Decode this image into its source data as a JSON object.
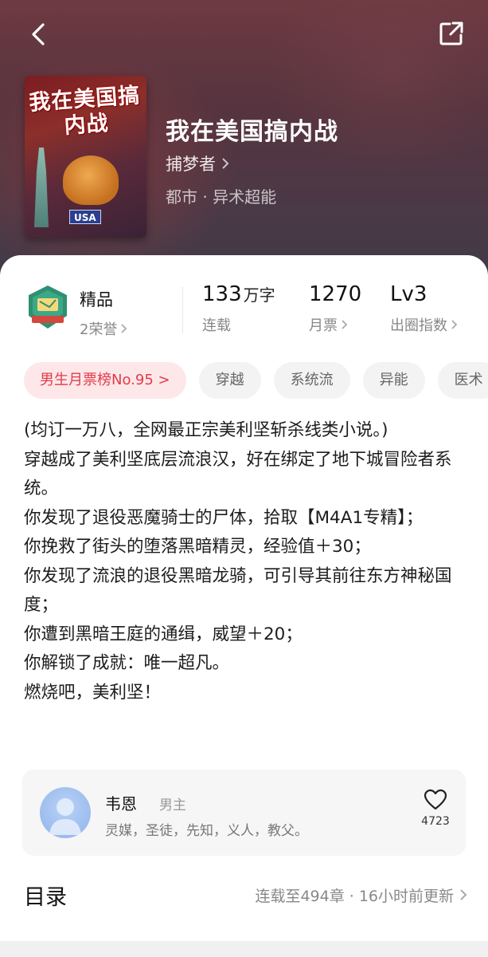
{
  "header": {
    "back_icon": "back-arrow-icon",
    "share_icon": "share-icon"
  },
  "book": {
    "cover_title": "我在美国搞内战",
    "cover_badge": "USA",
    "title": "我在美国搞内战",
    "author": "捕梦者",
    "genre": "都市 · 异术超能"
  },
  "stats": {
    "quality_label": "精品",
    "honors": "2荣誉",
    "words_value": "133",
    "words_unit": "万字",
    "words_label": "连载",
    "tickets_value": "1270",
    "tickets_label": "月票",
    "level_value": "Lv3",
    "level_label": "出圈指数"
  },
  "tags": [
    "男生月票榜No.95 >",
    "穿越",
    "系统流",
    "异能",
    "医术"
  ],
  "description": [
    "(均订一万八，全网最正宗美利坚斩杀线类小说。)",
    "穿越成了美利坚底层流浪汉，好在绑定了地下城冒险者系统。",
    "你发现了退役恶魔骑士的尸体，拾取【M4A1专精】；",
    "你挽救了街头的堕落黑暗精灵，经验值＋30；",
    "你发现了流浪的退役黑暗龙骑，可引导其前往东方神秘国度；",
    "你遭到黑暗王庭的通缉，威望＋20；",
    "你解锁了成就：唯一超凡。",
    "燃烧吧，美利坚！"
  ],
  "character": {
    "name": "韦恩",
    "role": "男主",
    "tags": "灵媒，圣徒，先知，义人，教父。",
    "likes": "4723"
  },
  "toc": {
    "title": "目录",
    "meta": "连载至494章 · 16小时前更新"
  },
  "colors": {
    "accent": "#e33b4b",
    "hero_bg": "#5a3640"
  }
}
